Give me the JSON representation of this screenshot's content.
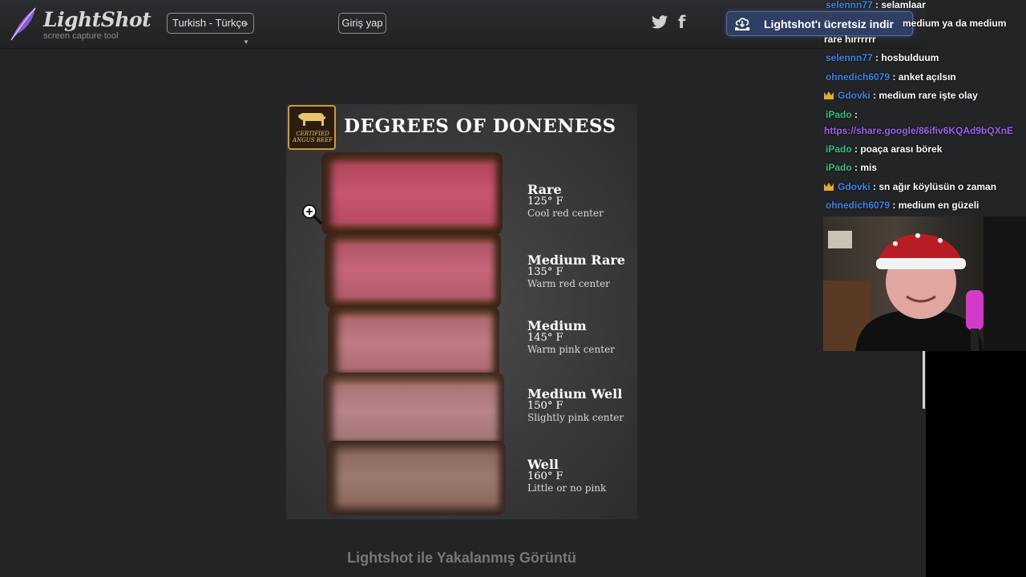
{
  "header": {
    "logo_title": "LightShot",
    "logo_subtitle": "screen capture tool",
    "language_selected": "Turkish - Türkçe",
    "login_label": "Giriş yap",
    "promo_text": "Lightshot'ı ücretsiz indir"
  },
  "screenshot": {
    "badge_text": "CERTIFIED ANGUS BEEF",
    "title": "DEGREES OF DONENESS",
    "levels": [
      {
        "name": "Rare",
        "temp": "125° F",
        "desc": "Cool red center"
      },
      {
        "name": "Medium Rare",
        "temp": "135° F",
        "desc": "Warm red center"
      },
      {
        "name": "Medium",
        "temp": "145° F",
        "desc": "Warm pink center"
      },
      {
        "name": "Medium Well",
        "temp": "150° F",
        "desc": "Slightly pink center"
      },
      {
        "name": "Well",
        "temp": "160° F",
        "desc": "Little or no pink"
      }
    ],
    "caption": "Lightshot ile Yakalanmış Görüntü"
  },
  "chat": {
    "messages": [
      {
        "user": "selennn77",
        "text": " : selamlaar"
      },
      {
        "user": "",
        "text": "medium ya da medium"
      },
      {
        "user": "",
        "text": "rare hırrrrrr"
      },
      {
        "user": "selennn77",
        "text": " : hosbulduum"
      },
      {
        "user": "ohnedich6079",
        "text": " : anket açılsın"
      },
      {
        "user": "Gdovki",
        "text": " : medium rare işte olay"
      },
      {
        "user": "iPado",
        "text": " :"
      },
      {
        "user": "",
        "text": "https://share.google/86ifiv6KQAd9bQXnE"
      },
      {
        "user": "iPado",
        "text": " : poaça arası börek"
      },
      {
        "user": "iPado",
        "text": " : mis"
      },
      {
        "user": "Gdovki",
        "text": " : sn ağır köylüsün o zaman"
      },
      {
        "user": "ohnedich6079",
        "text": " : medium en güzeli"
      }
    ]
  },
  "colors": {
    "background": "#232426",
    "promo_bg": "#2f3e63",
    "chat_user_blue": "#3e83e6",
    "chat_user_green": "#39c07c",
    "chat_link": "#9a63e6"
  }
}
